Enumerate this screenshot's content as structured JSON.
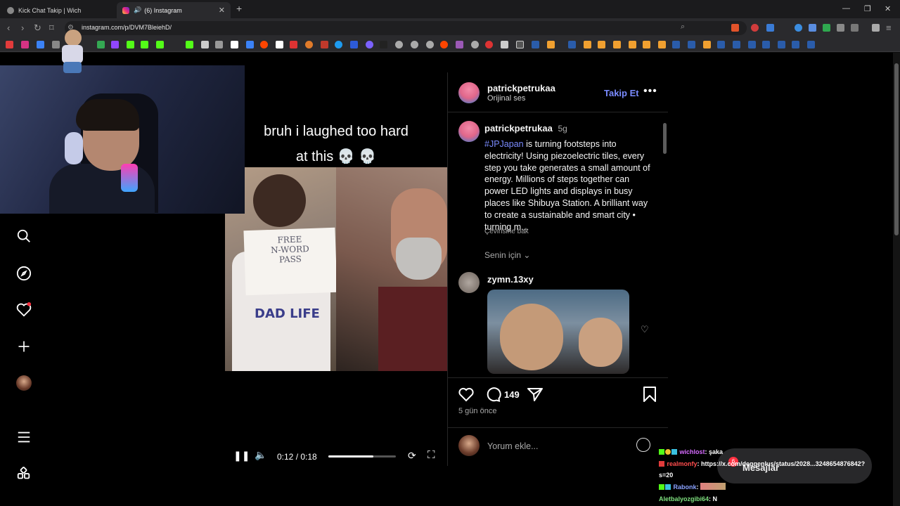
{
  "browser": {
    "tabs": [
      {
        "label": "Kick Chat Takip | Wich"
      },
      {
        "label": "(6) Instagram"
      }
    ],
    "url": "instagram.com/p/DVM7BleiehD/"
  },
  "video": {
    "overlay_line1": "bruh i laughed too hard",
    "overlay_line2": "at this 💀 💀",
    "sign_text": "FREE\nN-WORD\nPASS",
    "shirt_text": "DAD LIFE",
    "time": "0:12 / 0:18",
    "progress": 0.67
  },
  "post": {
    "author": "patrickpetrukaa",
    "audio": "Orijinal ses",
    "follow_label": "Takip Et",
    "caption_author": "patrickpetrukaa",
    "caption_age": "5g",
    "hashtag": "#JPJapan",
    "caption_text": " is turning footsteps into electricity! Using piezoelectric tiles, every step you take generates a small amount of energy. Millions of steps together can power LED lights and displays in busy places like Shibuya Station. A brilliant way to create a sustainable and smart city • turning m...",
    "translate_label": "Çevirisine bak",
    "for_you_label": "Senin için",
    "comment_author": "zymn.13xy",
    "comment_count": "149",
    "posted_ago": "5 gün önce",
    "comment_placeholder": "Yorum ekle..."
  },
  "chat": {
    "messages": [
      {
        "user": "wichlost",
        "text": ": şaka",
        "color": "#d66bff"
      },
      {
        "user": "realmonfy",
        "text": ": https://x.com/deggenlus/status/2028...3248654876842?",
        "color": "#ff4d4d"
      },
      {
        "user": "",
        "text": "s=20",
        "color": "#ffffff"
      },
      {
        "user": "Rabonk",
        "text": ":",
        "color": "#8aa2ff"
      },
      {
        "user": "Aletbalyozgibi64",
        "text": ": N",
        "color": "#7fe07f"
      }
    ],
    "messages_label": "Mesajlar",
    "messages_badge": "6"
  }
}
